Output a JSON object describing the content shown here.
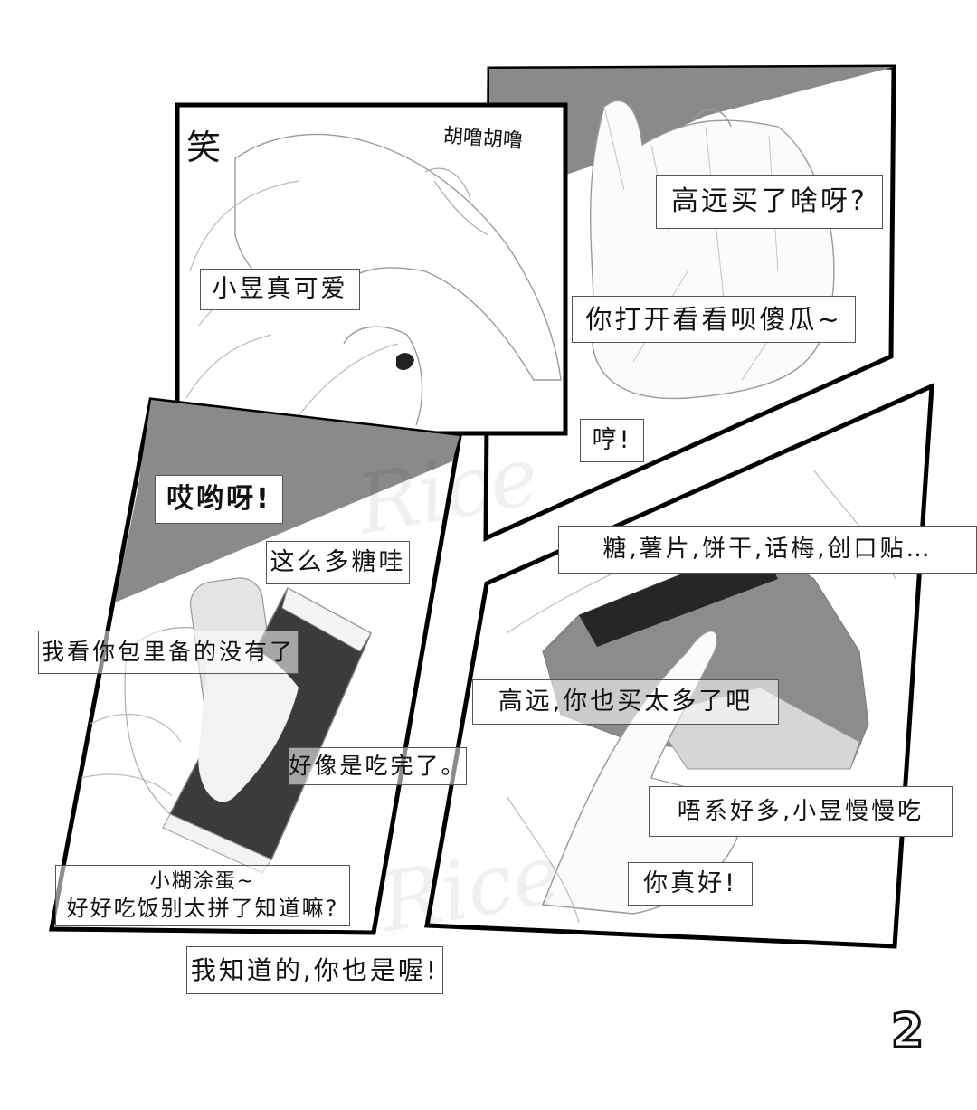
{
  "sfx": {
    "laugh": "笑",
    "rub": "胡噜胡噜"
  },
  "panel1": {
    "caption": "小昱真可爱"
  },
  "panel2": {
    "question": "高远买了啥呀?",
    "answer": "你打开看看呗傻瓜~",
    "hmph": "哼!"
  },
  "panel3": {
    "exclaim": "哎哟呀!",
    "so_much_candy": "这么多糖哇",
    "bag_empty": "我看你包里备的没有了",
    "finished": "好像是吃完了。",
    "silly_line1": "小糊涂蛋~",
    "silly_line2": "好好吃饭别太拼了知道嘛?",
    "reply": "我知道的,你也是喔!"
  },
  "panel4": {
    "items": "糖,薯片,饼干,话梅,创口贴…",
    "too_much": "高远,你也买太多了吧",
    "not_much": "唔系好多,小昱慢慢吃",
    "so_nice": "你真好!"
  },
  "watermark": "Rice",
  "page_number": "2"
}
